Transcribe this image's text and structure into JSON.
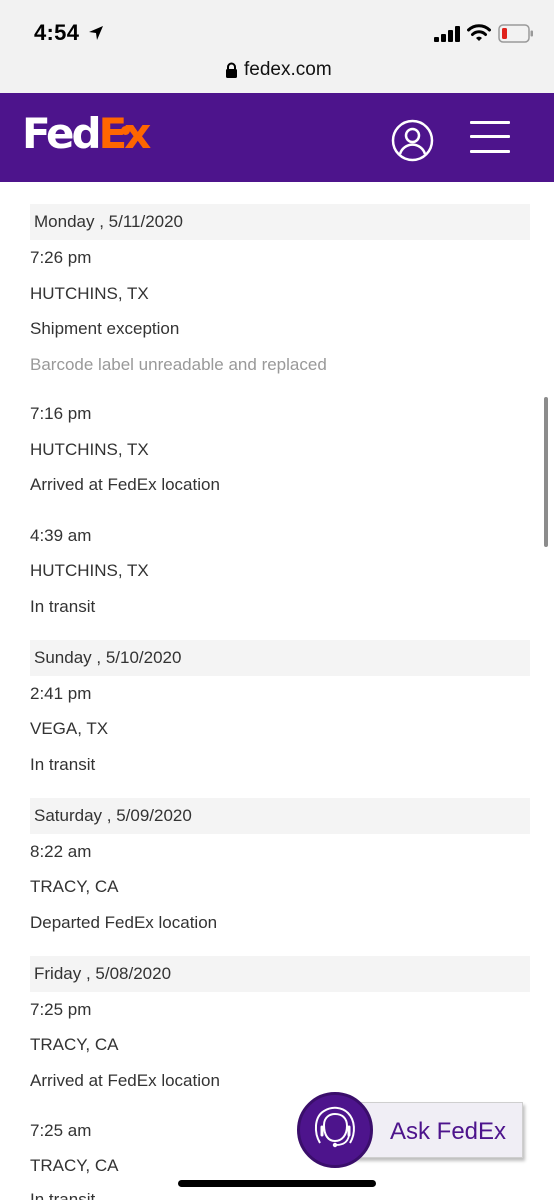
{
  "status_bar": {
    "time": "4:54"
  },
  "url_bar": {
    "domain": "fedex.com"
  },
  "header": {
    "logo_part1": "Fed",
    "logo_part2": "Ex",
    "brand_purple": "#4d148c",
    "brand_orange": "#ff6600"
  },
  "history": [
    {
      "date": "Monday , 5/11/2020",
      "events": [
        {
          "time": "7:26 pm",
          "location": "HUTCHINS, TX",
          "status": "Shipment exception",
          "detail": "Barcode label unreadable and replaced"
        },
        {
          "time": "7:16 pm",
          "location": "HUTCHINS, TX",
          "status": "Arrived at FedEx location"
        },
        {
          "time": "4:39 am",
          "location": "HUTCHINS, TX",
          "status": "In transit"
        }
      ]
    },
    {
      "date": "Sunday , 5/10/2020",
      "events": [
        {
          "time": "2:41 pm",
          "location": "VEGA, TX",
          "status": "In transit"
        }
      ]
    },
    {
      "date": "Saturday , 5/09/2020",
      "events": [
        {
          "time": "8:22 am",
          "location": "TRACY, CA",
          "status": "Departed FedEx location"
        }
      ]
    },
    {
      "date": "Friday , 5/08/2020",
      "events": [
        {
          "time": "7:25 pm",
          "location": "TRACY, CA",
          "status": "Arrived at FedEx location"
        },
        {
          "time": "7:25 am",
          "location": "TRACY, CA",
          "status": "In transit"
        }
      ]
    }
  ],
  "ask_widget": {
    "label": "Ask FedEx"
  }
}
